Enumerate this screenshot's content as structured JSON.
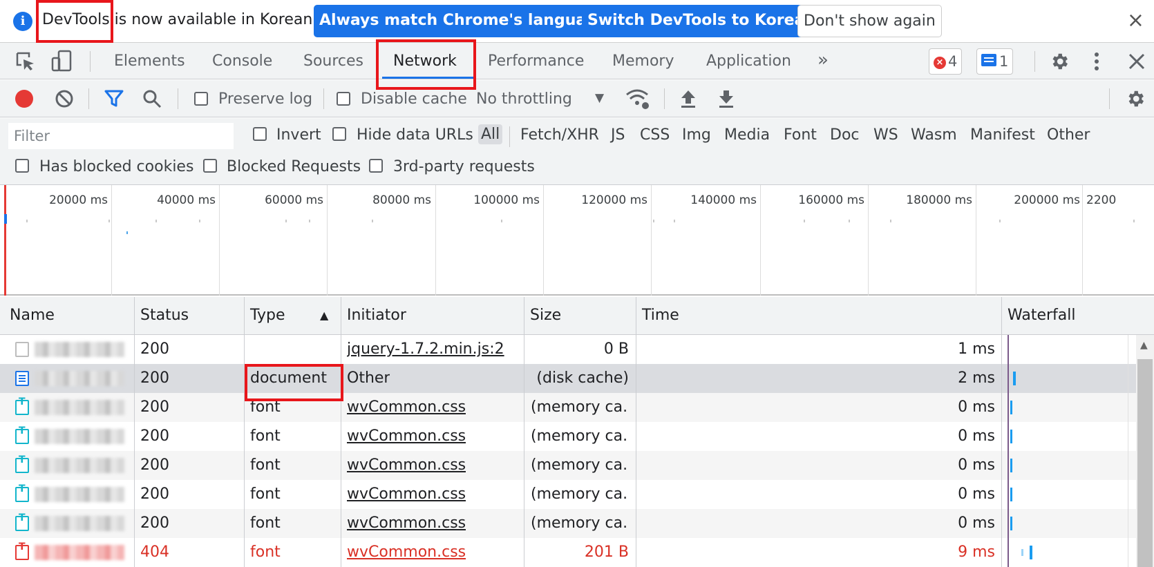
{
  "infobar": {
    "message": "DevTools is now available in Korean!",
    "btn_match": "Always match Chrome's language",
    "btn_switch": "Switch DevTools to Korean",
    "btn_dismiss": "Don't show again",
    "close": "×"
  },
  "tabs": {
    "more": "»",
    "items": [
      "Elements",
      "Console",
      "Sources",
      "Network",
      "Performance",
      "Memory",
      "Application"
    ],
    "errors_count": "4",
    "messages_count": "1"
  },
  "toolbar": {
    "preserve_log": "Preserve log",
    "disable_cache": "Disable cache",
    "throttling": "No throttling",
    "throttling_arrow": "▼"
  },
  "filter": {
    "placeholder": "Filter",
    "invert": "Invert",
    "hide_data_urls": "Hide data URLs",
    "types": [
      "All",
      "Fetch/XHR",
      "JS",
      "CSS",
      "Img",
      "Media",
      "Font",
      "Doc",
      "WS",
      "Wasm",
      "Manifest",
      "Other"
    ],
    "has_blocked_cookies": "Has blocked cookies",
    "blocked_requests": "Blocked Requests",
    "third_party": "3rd-party requests"
  },
  "overview": {
    "labels": [
      "20000 ms",
      "40000 ms",
      "60000 ms",
      "80000 ms",
      "100000 ms",
      "120000 ms",
      "140000 ms",
      "160000 ms",
      "180000 ms",
      "200000 ms",
      "2200"
    ]
  },
  "table": {
    "headers": {
      "name": "Name",
      "status": "Status",
      "type": "Type",
      "sort_arrow": "▲",
      "initiator": "Initiator",
      "size": "Size",
      "time": "Time",
      "waterfall": "Waterfall"
    },
    "rows": [
      {
        "status": "200",
        "type": "",
        "initiator": "jquery-1.7.2.min.js:2",
        "size": "0 B",
        "time": "1 ms"
      },
      {
        "status": "200",
        "type": "document",
        "initiator": "Other",
        "size": "(disk cache)",
        "time": "2 ms"
      },
      {
        "status": "200",
        "type": "font",
        "initiator": "wvCommon.css",
        "size": "(memory ca...",
        "time": "0 ms"
      },
      {
        "status": "200",
        "type": "font",
        "initiator": "wvCommon.css",
        "size": "(memory ca...",
        "time": "0 ms"
      },
      {
        "status": "200",
        "type": "font",
        "initiator": "wvCommon.css",
        "size": "(memory ca...",
        "time": "0 ms"
      },
      {
        "status": "200",
        "type": "font",
        "initiator": "wvCommon.css",
        "size": "(memory ca...",
        "time": "0 ms"
      },
      {
        "status": "200",
        "type": "font",
        "initiator": "wvCommon.css",
        "size": "(memory ca...",
        "time": "0 ms"
      },
      {
        "status": "404",
        "type": "font",
        "initiator": "wvCommon.css",
        "size": "201 B",
        "time": "9 ms"
      }
    ]
  }
}
